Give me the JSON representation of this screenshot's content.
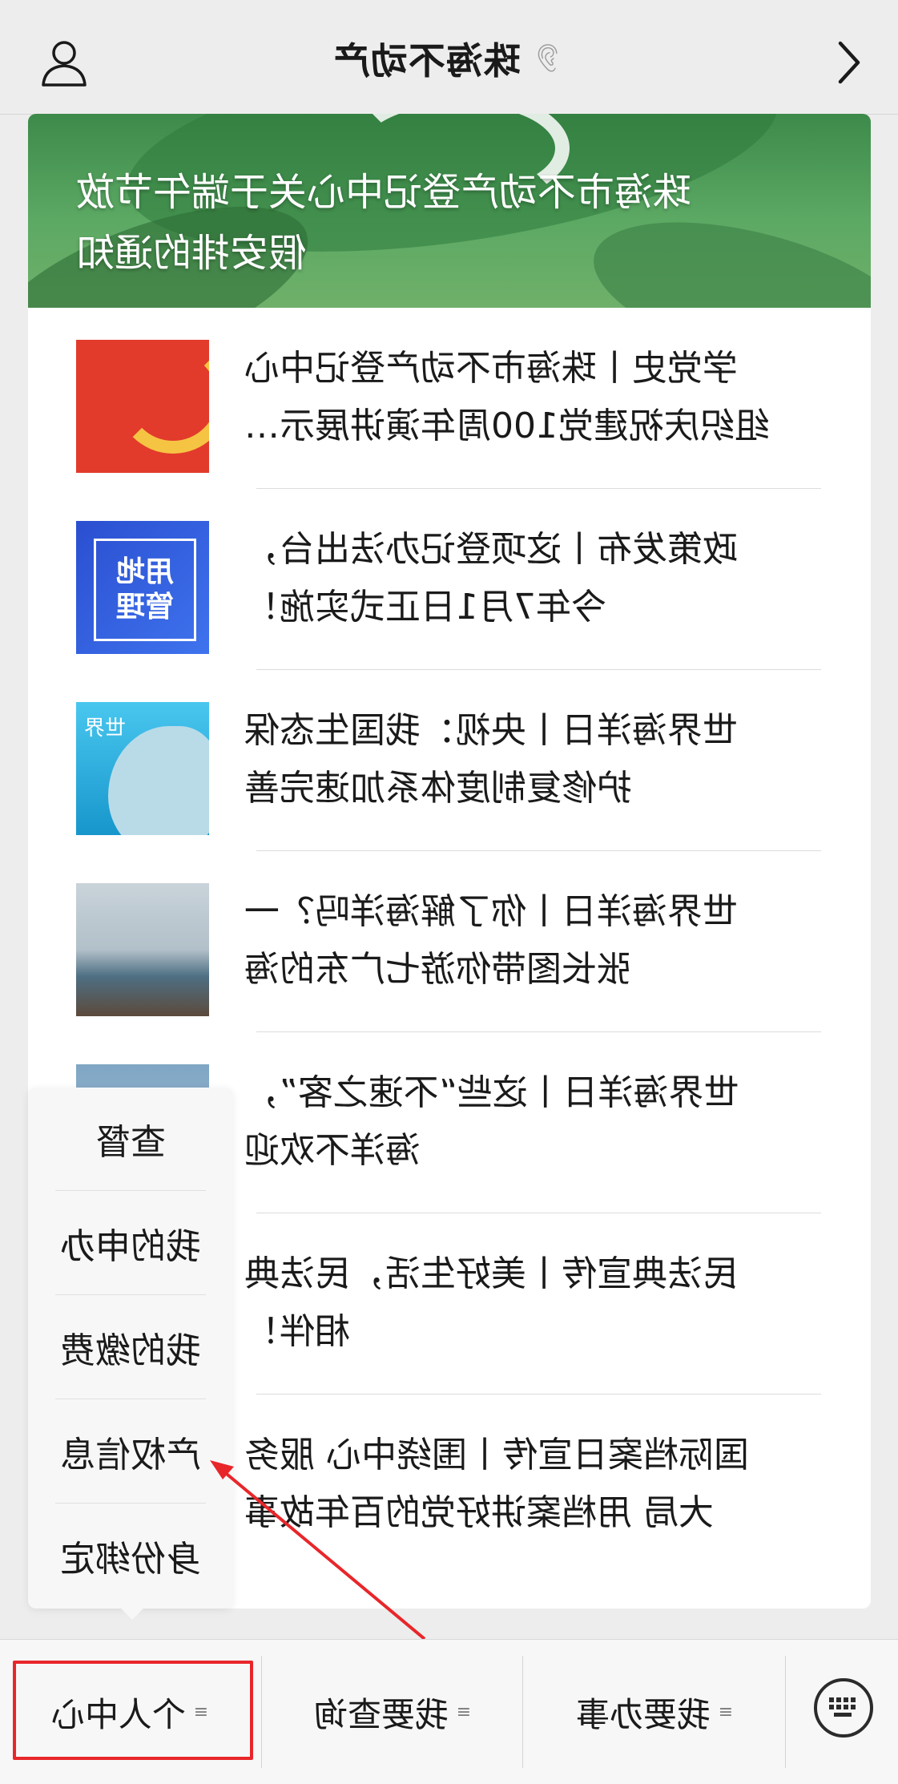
{
  "header": {
    "title": "珠海不动产",
    "ear_icon": "ear-icon",
    "left_icon": "person-icon",
    "right_icon": "chevron-right-icon"
  },
  "banner": {
    "caption_line1": "珠海市不动产登记中心关于端午节放",
    "caption_line2": "假安排的通知"
  },
  "articles": [
    {
      "line1": "学党史丨珠海市不动产登记中心",
      "line2": "组织庆祝建党100周年演讲展示…"
    },
    {
      "line1": "政策发布丨这项登记办法出台，",
      "line2": "今年7月1日正式实施！",
      "thumb_text1": "用地",
      "thumb_text2": "管理"
    },
    {
      "line1": "世界海洋日丨央视：我国生态保",
      "line2": "护修复制度体系加速完善",
      "thumb_text": "世界"
    },
    {
      "line1": "世界海洋日丨你了解海洋吗？一",
      "line2": "张长图带你游七广东的海"
    },
    {
      "line1": "世界海洋日丨这些“不速之客”，",
      "line2": "海洋不欢迎"
    },
    {
      "line1": "民法典宣传丨美好生活，民法典",
      "line2": "相伴！"
    },
    {
      "line1": "国际档案日宣传丨围绕中心 服务",
      "line2": "大局 用档案讲好党的百年故事"
    }
  ],
  "popup_menu": [
    "查督",
    "我的申办",
    "我的缴费",
    "产权信息",
    "身份绑定"
  ],
  "bottom_tabs": [
    "个人中心",
    "我要查询",
    "我要办事"
  ],
  "colors": {
    "highlight": "#e8262a",
    "banner_green": "#4f9b57",
    "background": "#ededed"
  }
}
